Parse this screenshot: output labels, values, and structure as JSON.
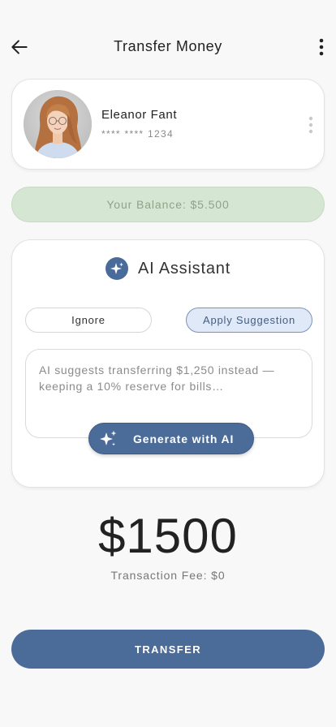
{
  "header": {
    "title": "Transfer Money",
    "back_icon": "arrow-left-icon",
    "more_icon": "more-vertical-icon"
  },
  "recipient": {
    "name": "Eleanor Fant",
    "card_number": "**** **** 1234",
    "more_icon": "more-vertical-icon"
  },
  "balance": {
    "text": "Your Balance: $5.500"
  },
  "ai_assistant": {
    "title": "AI Assistant",
    "icon": "sparkle-icon",
    "ignore_label": "Ignore",
    "apply_label": "Apply Suggestion",
    "suggestion_text": "AI suggests transferring $1,250 instead — keeping a 10% reserve for bills…",
    "generate_label": "Generate with AI"
  },
  "amount": {
    "value": "$1500",
    "fee": "Transaction Fee: $0"
  },
  "transfer": {
    "label": "TRANSFER"
  },
  "colors": {
    "primary": "#4b6b99",
    "balance_bg": "#d5e7d2",
    "balance_text": "#8ea48a",
    "apply_bg": "#dfe9f8"
  }
}
